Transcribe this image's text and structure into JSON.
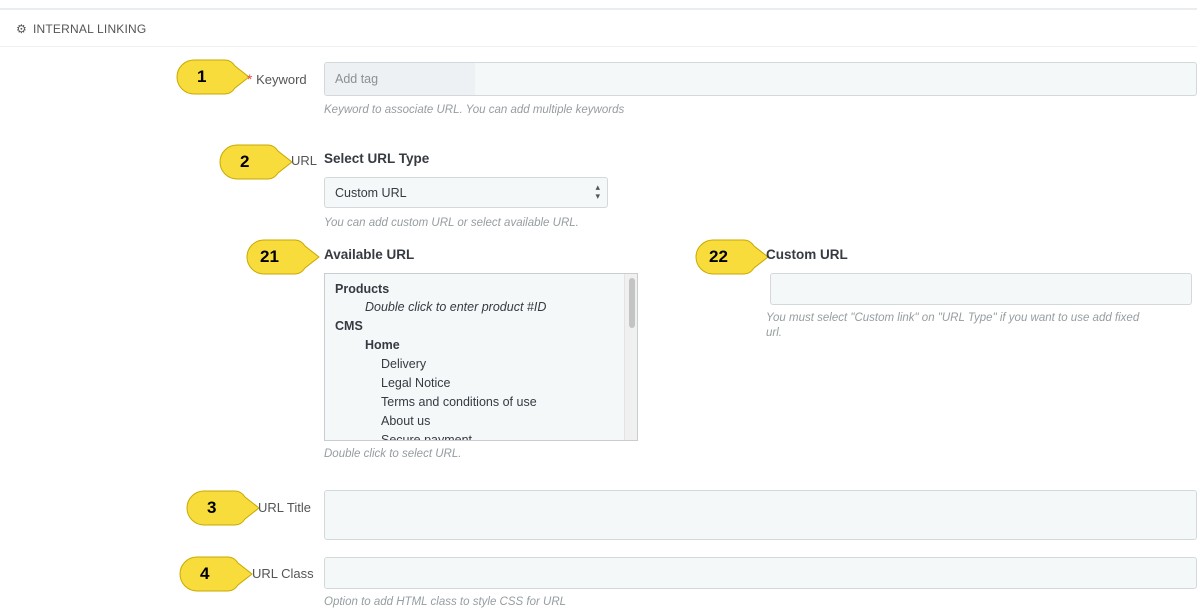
{
  "section": {
    "title": "INTERNAL LINKING",
    "icon": "gears-icon"
  },
  "keyword": {
    "label": "Keyword",
    "required_mark": "*",
    "placeholder": "Add tag",
    "hint": "Keyword to associate URL. You can add multiple keywords"
  },
  "url": {
    "label": "URL",
    "select_heading": "Select URL Type",
    "select_value": "Custom URL",
    "hint": "You can add custom URL or select available URL."
  },
  "available_url": {
    "heading": "Available URL",
    "items": [
      {
        "text": "Products",
        "style": "b"
      },
      {
        "text": "Double click to enter product #ID",
        "style": "i"
      },
      {
        "text": "CMS",
        "style": "b"
      },
      {
        "text": "Home",
        "style": "b"
      },
      {
        "text": "Delivery",
        "style": ""
      },
      {
        "text": "Legal Notice",
        "style": ""
      },
      {
        "text": "Terms and conditions of use",
        "style": ""
      },
      {
        "text": "About us",
        "style": ""
      },
      {
        "text": "Secure payment",
        "style": ""
      }
    ],
    "hint": "Double click to select URL."
  },
  "custom_url": {
    "heading": "Custom URL",
    "hint_line1": "You must select \"Custom link\" on \"URL Type\" if you want to use add fixed",
    "hint_line2": "url."
  },
  "url_title": {
    "label": "URL Title"
  },
  "url_class": {
    "label": "URL Class",
    "hint": "Option to add HTML class to style CSS for URL"
  },
  "callouts": [
    "1",
    "2",
    "21",
    "22",
    "3",
    "4"
  ],
  "colors": {
    "callout_fill": "#f7dc3b",
    "required": "#e84e42"
  }
}
